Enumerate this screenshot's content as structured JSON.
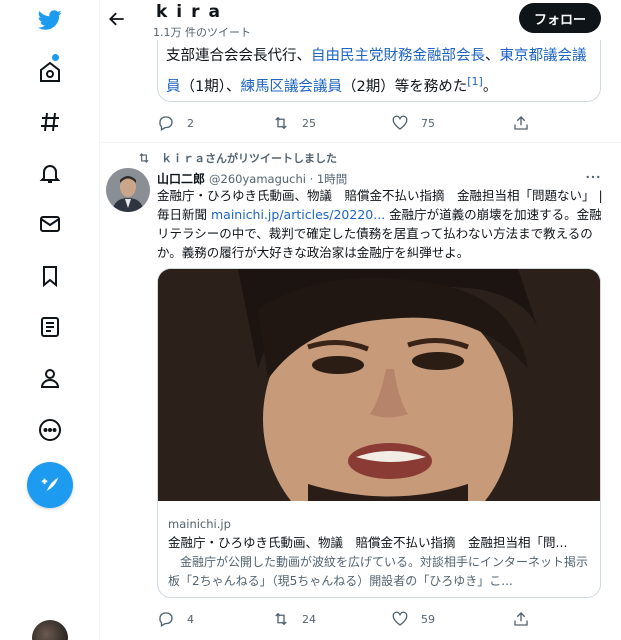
{
  "header": {
    "name": "kira",
    "tweet_count": "1.1万 件のツイート",
    "follow_label": "フォロー"
  },
  "tweet1": {
    "t1": "支部連合会会長代行、",
    "l1": "自由民主党財務金融部会長",
    "t2": "、",
    "l2": "東京都議会議員",
    "t3": "（1期）、",
    "l3": "練馬区議会議員",
    "t4": "（2期）等を務めた",
    "ref": "[1]",
    "t5": "。",
    "replies": "2",
    "retweets": "25",
    "likes": "75"
  },
  "tweet2": {
    "retweeted_by": "ｋｉｒａさんがリツイートしました",
    "name": "山口二郎",
    "handle_time": "@260yamaguchi · 1時間",
    "b1": "金融庁・ひろゆき氏動画、物議　賠償金不払い指摘　金融担当相「問題ない」 | 毎日新聞 ",
    "link": "mainichi.jp/articles/20220...",
    "b2": " 金融庁が道義の崩壊を加速する。金融リテラシーの中で、裁判で確定した債務を居直って払わない方法まで教えるのか。義務の履行が大好きな政治家は金融庁を糾弾せよ。",
    "card": {
      "domain": "mainichi.jp",
      "title": "金融庁・ひろゆき氏動画、物議　賠償金不払い指摘　金融担当相「問...",
      "description": "金融庁が公開した動画が波紋を広げている。対談相手にインターネット掲示板「2ちゃんねる」（現5ちゃんねる）開設者の「ひろゆき」こ..."
    },
    "replies": "4",
    "retweets": "24",
    "likes": "59"
  },
  "icons": {
    "logo": "twitter-bird-icon",
    "explore": "hashtag-icon",
    "notifications": "bell-icon",
    "messages": "mail-icon",
    "bookmarks": "bookmark-icon",
    "lists": "list-icon",
    "profile": "person-icon",
    "more": "more-circle-icon",
    "tweet": "compose-icon"
  },
  "colors": {
    "accent": "#1d9bf0",
    "link": "#1d64c4",
    "text": "#0f1419",
    "muted": "#536471"
  }
}
